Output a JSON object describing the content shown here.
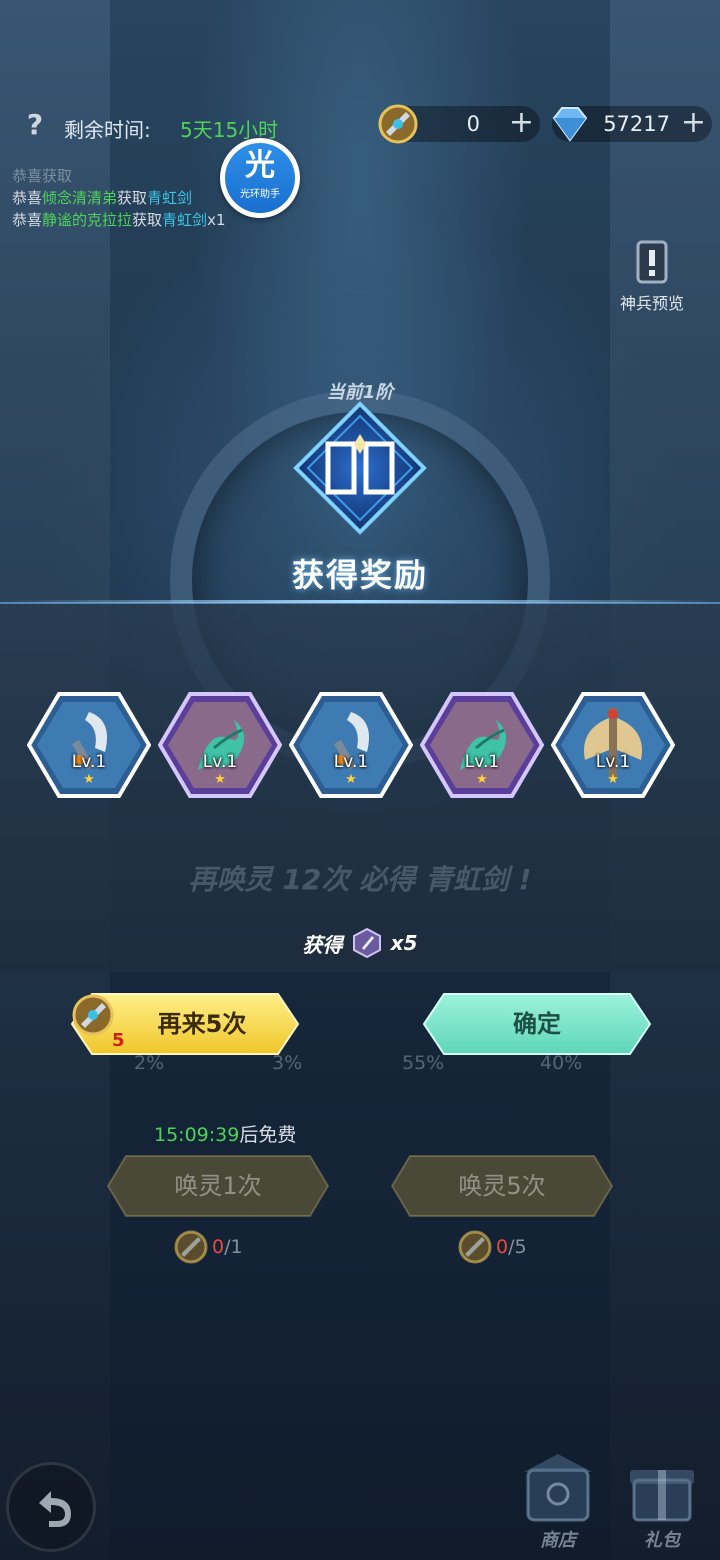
{
  "top_bar": {
    "time_label": "剩余时间:",
    "time_value": "5天15小时",
    "currency_gold": "0",
    "currency_diamond": "57217"
  },
  "broadcast": {
    "line1": {
      "prefix": "恭喜",
      "player": "",
      "action": "获取",
      "item": ""
    },
    "line2": {
      "prefix": "恭喜",
      "player": "倾念清清弟",
      "action": "获取",
      "item": "青虹剑"
    },
    "line3": {
      "prefix": "恭喜",
      "player": "静谧的克拉拉",
      "action": "获取",
      "item": "青虹剑",
      "suffix": "x1"
    }
  },
  "helper_badge": {
    "glyph": "光",
    "text": "光环助手"
  },
  "preview_button": {
    "label": "神兵预览"
  },
  "tier_label": "当前1阶",
  "reward_dialog": {
    "title": "获得奖励",
    "items": [
      {
        "name": "scythe",
        "level": "Lv.1",
        "star": "★",
        "rarity": "blue"
      },
      {
        "name": "jade-serpent",
        "level": "Lv.1",
        "star": "★",
        "rarity": "purple"
      },
      {
        "name": "scythe",
        "level": "Lv.1",
        "star": "★",
        "rarity": "blue"
      },
      {
        "name": "jade-serpent",
        "level": "Lv.1",
        "star": "★",
        "rarity": "purple"
      },
      {
        "name": "battle-axe",
        "level": "Lv.1",
        "star": "★",
        "rarity": "blue"
      }
    ],
    "pity_text": "再唤灵 12次 必得 青虹剑 !",
    "obtained_label": "获得",
    "obtained_count": "x5",
    "again_button": "再来5次",
    "again_cost": "5",
    "confirm_button": "确定"
  },
  "draw_panel": {
    "odds": [
      "2%",
      "3%",
      "55%",
      "40%"
    ],
    "free_timer_value": "15:09:39",
    "free_timer_suffix": "后免费",
    "summon_one": "唤灵1次",
    "summon_five": "唤灵5次",
    "cost_one": {
      "have": "0",
      "need": "/1"
    },
    "cost_five": {
      "have": "0",
      "need": "/5"
    }
  },
  "bottom_nav": {
    "shop": "商店",
    "gift": "礼包"
  },
  "colors": {
    "accent_green": "#4ed35a",
    "gold_button": "#f3d443",
    "teal_button": "#6fe0c6",
    "warning_red": "#d01f1f"
  }
}
